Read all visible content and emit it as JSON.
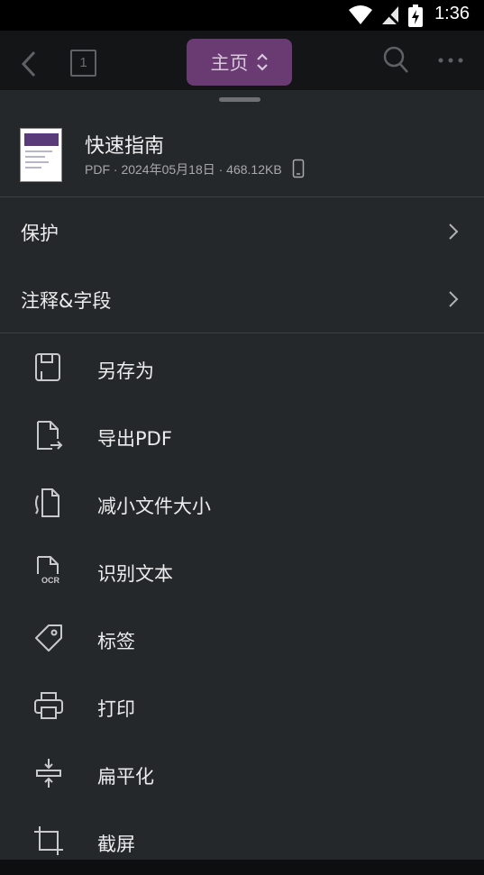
{
  "status_bar": {
    "time": "1:36"
  },
  "toolbar": {
    "page_number": "1",
    "home_label": "主页"
  },
  "file": {
    "title": "快速指南",
    "meta": "PDF · 2024年05月18日 · 468.12KB"
  },
  "sections": [
    {
      "label": "保护",
      "icon": "chevron-right-icon"
    },
    {
      "label": "注释&字段",
      "icon": "chevron-right-icon"
    }
  ],
  "menu": [
    {
      "label": "另存为",
      "icon": "save-icon"
    },
    {
      "label": "导出PDF",
      "icon": "export-icon"
    },
    {
      "label": "减小文件大小",
      "icon": "compress-icon"
    },
    {
      "label": "识别文本",
      "icon": "ocr-icon",
      "badge": "OCR"
    },
    {
      "label": "标签",
      "icon": "tag-icon"
    },
    {
      "label": "打印",
      "icon": "print-icon"
    },
    {
      "label": "扁平化",
      "icon": "flatten-icon"
    },
    {
      "label": "截屏",
      "icon": "crop-icon"
    }
  ],
  "colors": {
    "sheet_bg": "#25282b",
    "accent_pill": "#6a3a73",
    "toolbar_bg": "#141517"
  }
}
